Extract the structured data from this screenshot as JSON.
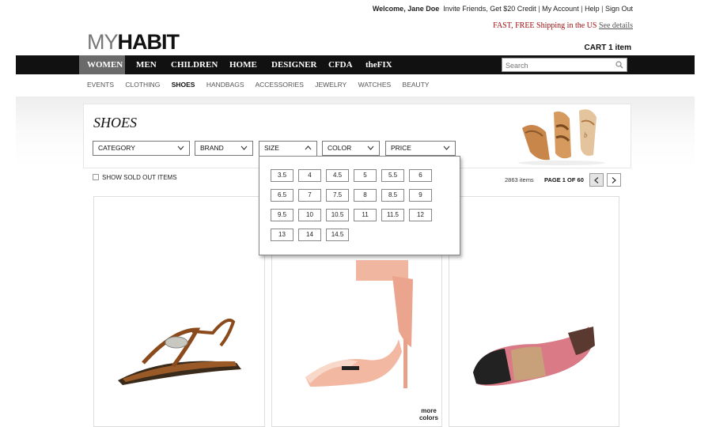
{
  "topbar": {
    "welcome": "Welcome, Jane Doe",
    "invite": "Invite Friends, Get $20 Credit",
    "account": "My Account",
    "help": "Help",
    "signout": "Sign Out",
    "sep": "|"
  },
  "brand": {
    "logo_my": "MY",
    "logo_habit": "HABIT"
  },
  "shipping": {
    "text": "FAST, FREE Shipping in the US ",
    "details": "See details"
  },
  "cart": {
    "label": "CART 1 item"
  },
  "nav": {
    "items": [
      "WOMEN",
      "MEN",
      "CHILDREN",
      "HOME",
      "DESIGNER",
      "CFDA",
      "theFIX"
    ],
    "active": "WOMEN"
  },
  "search": {
    "placeholder": "Search",
    "icon": "search-icon"
  },
  "subnav": {
    "items": [
      "EVENTS",
      "CLOTHING",
      "SHOES",
      "HANDBAGS",
      "ACCESSORIES",
      "JEWELRY",
      "WATCHES",
      "BEAUTY"
    ],
    "active": "SHOES"
  },
  "page": {
    "title": "SHOES"
  },
  "filters": {
    "category": "CATEGORY",
    "brand": "BRAND",
    "size": "SIZE",
    "color": "COLOR",
    "price": "PRICE"
  },
  "sizes": [
    "3.5",
    "4",
    "4.5",
    "5",
    "5.5",
    "6",
    "6.5",
    "7",
    "7.5",
    "8",
    "8.5",
    "9",
    "9.5",
    "10",
    "10.5",
    "11",
    "11.5",
    "12",
    "13",
    "14",
    "14.5"
  ],
  "listing": {
    "show_sold_out": "SHOW SOLD OUT ITEMS",
    "count": "2863 items",
    "page_info": "PAGE 1 OF 60"
  },
  "products": [
    {
      "name": "braided-thong-sandal",
      "more": ""
    },
    {
      "name": "ankle-strap-heel",
      "more_line1": "more",
      "more_line2": "colors"
    },
    {
      "name": "ballet-flat",
      "more": ""
    }
  ],
  "colors": {
    "nav_bg": "#111111",
    "nav_active": "#6a6a6a",
    "shipping_red": "#a01010"
  }
}
